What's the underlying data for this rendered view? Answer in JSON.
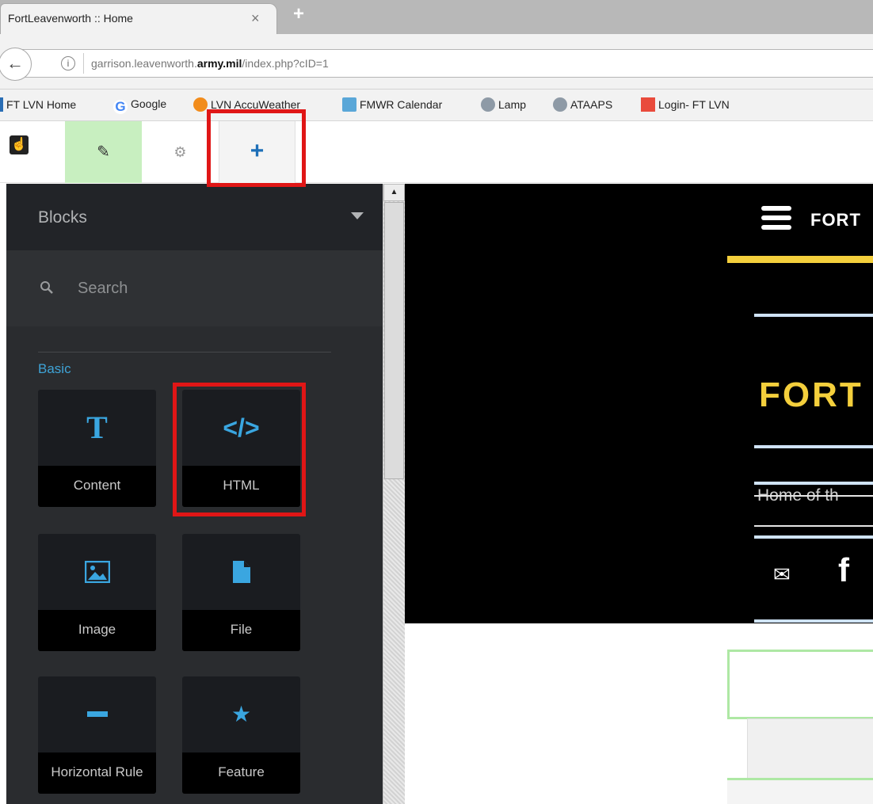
{
  "browser": {
    "tab_title": "FortLeavenworth :: Home",
    "tab_close": "×",
    "new_tab": "+",
    "url_prefix": "garrison.leavenworth.",
    "url_domain": "army.mil",
    "url_path": "/index.php?cID=1",
    "back_glyph": "←",
    "info_glyph": "i"
  },
  "bookmarks": [
    {
      "label": "FT LVN Home",
      "icon_color": "#2a6eb5"
    },
    {
      "label": "Google",
      "icon_color": "#4285f4"
    },
    {
      "label": "LVN AccuWeather",
      "icon_color": "#f28c1b"
    },
    {
      "label": "FMWR Calendar",
      "icon_color": "#5aa7d8"
    },
    {
      "label": "Lamp",
      "icon_color": "#8e9aa6"
    },
    {
      "label": "ATAAPS",
      "icon_color": "#8e9aa6"
    },
    {
      "label": "Login- FT LVN",
      "icon_color": "#e94b3c"
    }
  ],
  "toolbar": {
    "logo_glyph": "☝",
    "edit_glyph": "✎",
    "settings_glyph": "⚙",
    "add_glyph": "+"
  },
  "sidebar": {
    "title": "Blocks",
    "search_placeholder": "Search",
    "search_glyph": "🔍",
    "section_label": "Basic",
    "blocks": [
      {
        "label": "Content",
        "icon": "T"
      },
      {
        "label": "HTML",
        "icon": "</>"
      },
      {
        "label": "Image",
        "icon": "▣"
      },
      {
        "label": "File",
        "icon": "▮"
      },
      {
        "label": "Horizontal Rule",
        "icon": "━"
      },
      {
        "label": "Feature",
        "icon": "★"
      }
    ]
  },
  "scrollbar": {
    "up_glyph": "▲"
  },
  "page": {
    "brand_small": "FORT",
    "brand_big": "FORT",
    "tagline": "Home of th",
    "mail_glyph": "✉",
    "facebook_glyph": "f"
  },
  "colors": {
    "accent_blue": "#3aa6e0",
    "yellow": "#f4cf3c",
    "highlight_red": "#e01616"
  }
}
